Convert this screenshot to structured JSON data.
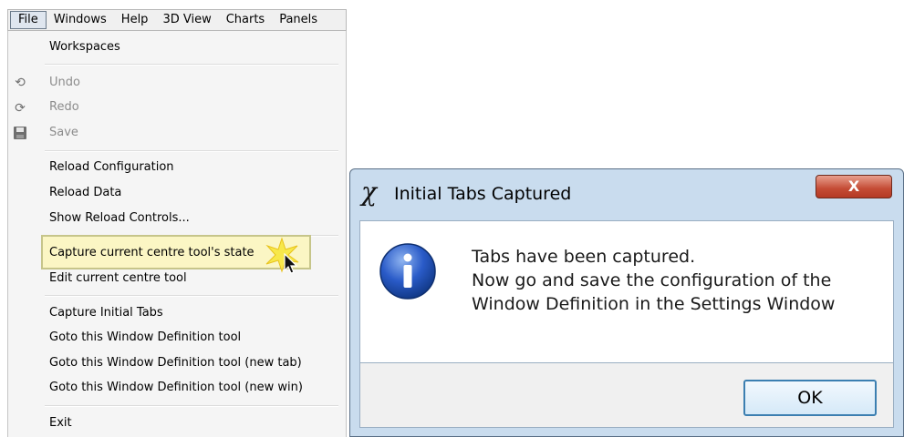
{
  "menubar": {
    "items": [
      "File",
      "Windows",
      "Help",
      "3D View",
      "Charts",
      "Panels"
    ]
  },
  "file_menu": {
    "workspaces": "Workspaces",
    "undo": "Undo",
    "redo": "Redo",
    "save": "Save",
    "reload_configuration": "Reload Configuration",
    "reload_data": "Reload Data",
    "show_reload_controls": "Show Reload Controls...",
    "capture_state": "Capture current centre tool's state",
    "edit_tool": "Edit current centre tool",
    "capture_tabs": "Capture Initial Tabs",
    "goto_window_def": "Goto this Window Definition tool",
    "goto_window_def_tab": "Goto this Window Definition tool (new tab)",
    "goto_window_def_win": "Goto this Window Definition tool (new win)",
    "exit": "Exit",
    "icons": {
      "undo": "undo-icon",
      "redo": "redo-icon",
      "save": "save-icon"
    }
  },
  "dialog": {
    "title_symbol": "χ",
    "title": "Initial Tabs Captured",
    "close_label": "X",
    "message_lines": [
      "Tabs have been captured.",
      "Now go and save the configuration of the",
      "Window Definition in the Settings Window"
    ],
    "ok_label": "OK",
    "icon": "info-icon"
  },
  "colors": {
    "highlight_bg": "#fbf6c4",
    "dialog_frame": "#c9dcee",
    "close_red": "#c44b34",
    "ok_border": "#3c7fb1"
  }
}
